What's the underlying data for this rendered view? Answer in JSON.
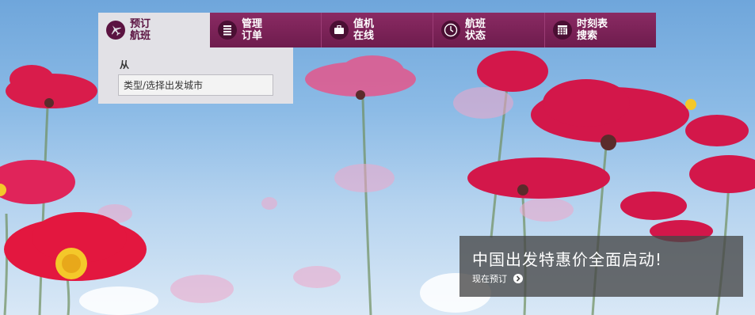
{
  "nav": {
    "tabs": [
      {
        "line1": "预订",
        "line2": "航班",
        "icon": "airplane-icon",
        "active": true
      },
      {
        "line1": "管理",
        "line2": "订单",
        "icon": "list-icon",
        "active": false
      },
      {
        "line1": "值机",
        "line2": "在线",
        "icon": "suitcase-icon",
        "active": false
      },
      {
        "line1": "航班",
        "line2": "状态",
        "icon": "clock-icon",
        "active": false
      },
      {
        "line1": "时刻表",
        "line2": "搜索",
        "icon": "calendar-icon",
        "active": false
      }
    ]
  },
  "booking": {
    "from_label": "从",
    "from_placeholder": "类型/选择出发城市"
  },
  "promo": {
    "headline": "中国出发特惠价全面启动!",
    "cta_label": "现在预订",
    "cta_icon": "chevron-right-icon"
  },
  "colors": {
    "brand": "#6e1c4d",
    "panel_bg": "#e2e1e6"
  }
}
